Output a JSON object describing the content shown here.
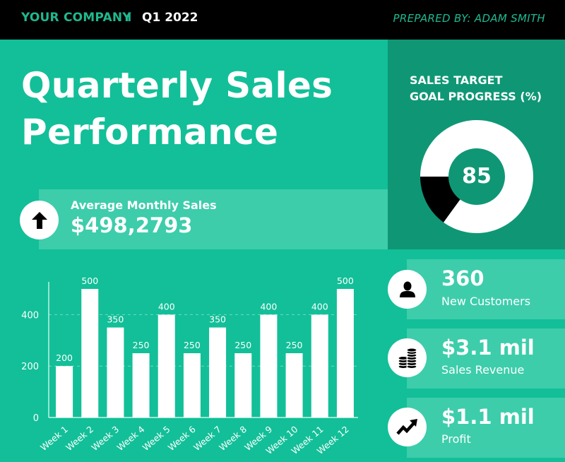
{
  "header": {
    "company": "YOUR COMPANY",
    "separator": "I",
    "quarter": "Q1 2022",
    "prepared_by": "PREPARED BY: ADAM SMITH"
  },
  "title": {
    "line1": "Quarterly Sales",
    "line2": "Performance"
  },
  "goal": {
    "title_line1": "SALES TARGET",
    "title_line2": "GOAL PROGRESS (%)",
    "value": "85",
    "percent": 85,
    "colors": {
      "achieved": "#ffffff",
      "remaining": "#000000"
    }
  },
  "average": {
    "icon": "arrow-up-icon",
    "label": "Average Monthly Sales",
    "value": "$498,2793"
  },
  "stats": [
    {
      "icon": "user-icon",
      "value": "360",
      "label": "New Customers"
    },
    {
      "icon": "coins-icon",
      "value": "$3.1 mil",
      "label": "Sales Revenue"
    },
    {
      "icon": "trend-up-icon",
      "value": "$1.1 mil",
      "label": "Profit"
    }
  ],
  "colors": {
    "background": "#12bf98",
    "panel_dark": "#0f9775",
    "card_light": "#3dcdab",
    "accent_text": "#1fb98f",
    "header_bg": "#000000"
  },
  "chart_data": {
    "type": "bar",
    "title": "",
    "xlabel": "",
    "ylabel": "",
    "categories": [
      "Week 1",
      "Week 2",
      "Week 3",
      "Week 4",
      "Week 5",
      "Week 6",
      "Week 7",
      "Week 8",
      "Week 9",
      "Week 10",
      "Week 11",
      "Week 12"
    ],
    "values": [
      200,
      500,
      350,
      250,
      400,
      250,
      350,
      250,
      400,
      250,
      400,
      500
    ],
    "data_labels": [
      "200",
      "500",
      "350",
      "250",
      "400",
      "250",
      "350",
      "250",
      "400",
      "250",
      "400",
      "500"
    ],
    "ylim": [
      0,
      500
    ],
    "yticks": [
      0,
      200,
      400
    ],
    "ytick_labels": [
      "0",
      "200",
      "400"
    ],
    "grid": "horizontal-dashed",
    "legend": "none",
    "bar_color": "#ffffff"
  }
}
